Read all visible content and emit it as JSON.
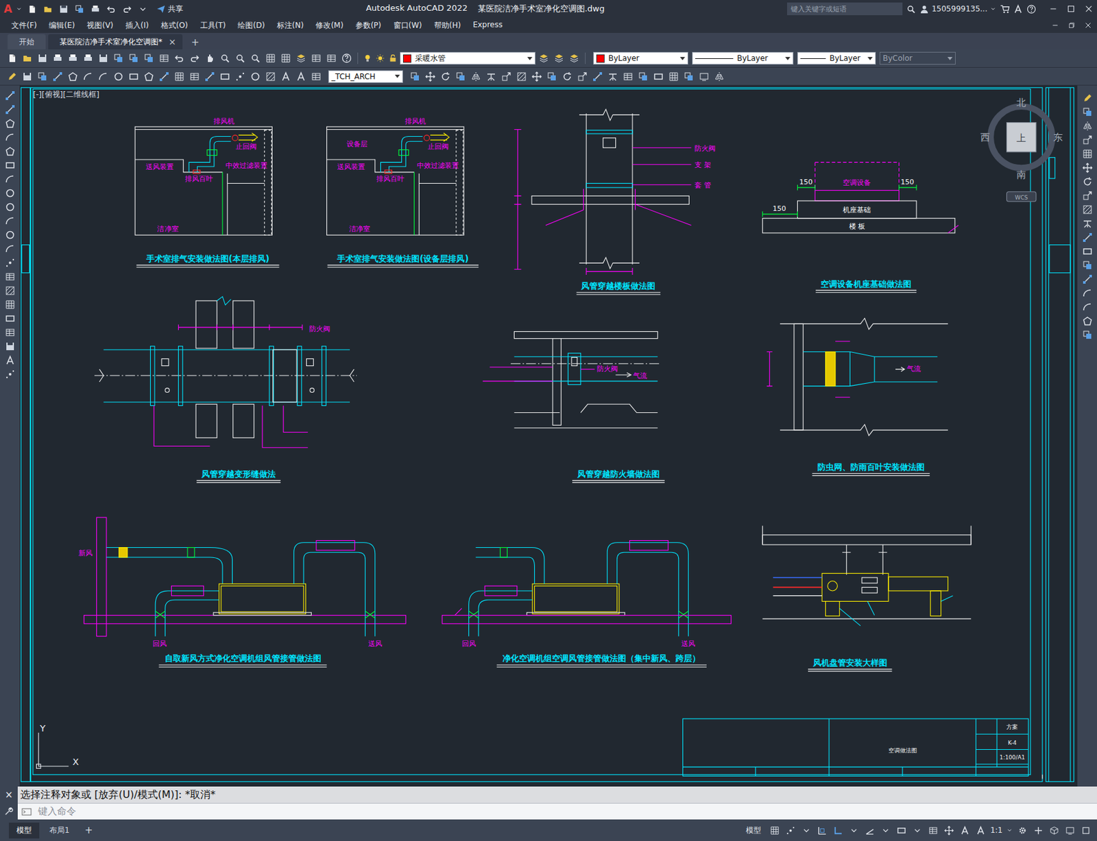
{
  "window": {
    "logo": "A",
    "app": "Autodesk AutoCAD 2022",
    "file": "某医院洁净手术室净化空调图.dwg",
    "share": "共享",
    "search_placeholder": "键入关键字或短语",
    "user": "1505999135..."
  },
  "menu": [
    "文件(F)",
    "编辑(E)",
    "视图(V)",
    "插入(I)",
    "格式(O)",
    "工具(T)",
    "绘图(D)",
    "标注(N)",
    "修改(M)",
    "参数(P)",
    "窗口(W)",
    "帮助(H)",
    "Express"
  ],
  "doc_tabs": [
    {
      "label": "开始",
      "selected": false,
      "closable": false
    },
    {
      "label": "某医院洁净手术室净化空调图*",
      "selected": true,
      "closable": true
    }
  ],
  "tab_close": "×",
  "tab_add": "+",
  "properties": {
    "layer": "采暖水管",
    "layer_color": "#ff0000",
    "color": "ByLayer",
    "color_swatch": "#ff0000",
    "linetype": "ByLayer",
    "lineweight": "ByLayer",
    "plotstyle": "ByColor",
    "plotstyle_disabled": true
  },
  "text_style": "_TCH_ARCH",
  "viewport": {
    "label": "[-][俯视][二维线框]",
    "compass": {
      "north": "北",
      "south": "南",
      "west": "西",
      "east": "东",
      "top": "上",
      "wcs": "WCS"
    },
    "ucs": {
      "x": "X",
      "y": "Y"
    }
  },
  "details": [
    {
      "title": "手术室排气安装做法图(本层排风)",
      "labels": [
        {
          "text": "排风机",
          "color": "#ff00ff"
        },
        {
          "text": "止回阀",
          "color": "#ff00ff"
        },
        {
          "text": "送风装置",
          "color": "#ff00ff"
        },
        {
          "text": "中效过滤装置",
          "color": "#ff00ff"
        },
        {
          "text": "排风百叶",
          "color": "#ff00ff"
        },
        {
          "text": "洁净室",
          "color": "#ff00ff"
        }
      ]
    },
    {
      "title": "手术室排气安装做法图(设备层排风)",
      "labels": [
        {
          "text": "排风机",
          "color": "#ff00ff"
        },
        {
          "text": "设备层",
          "color": "#ff00ff"
        },
        {
          "text": "止回阀",
          "color": "#ff00ff"
        },
        {
          "text": "送风装置",
          "color": "#ff00ff"
        },
        {
          "text": "中效过滤装置",
          "color": "#ff00ff"
        },
        {
          "text": "排风百叶",
          "color": "#ff00ff"
        },
        {
          "text": "洁净室",
          "color": "#ff00ff"
        }
      ]
    },
    {
      "title": "风管穿越楼板做法图",
      "labels": [
        {
          "text": "防火阀",
          "color": "#ff00ff"
        },
        {
          "text": "支 架",
          "color": "#ff00ff"
        },
        {
          "text": "套 管",
          "color": "#ff00ff"
        }
      ]
    },
    {
      "title": "空调设备机座基础做法图",
      "labels": [
        {
          "text": "空调设备",
          "color": "#ff00ff"
        },
        {
          "text": "150",
          "color": "#ffffff"
        },
        {
          "text": "150",
          "color": "#ffffff"
        },
        {
          "text": "150",
          "color": "#ffffff"
        },
        {
          "text": "机座基础",
          "color": "#ffffff"
        },
        {
          "text": "楼 板",
          "color": "#ffffff"
        }
      ]
    },
    {
      "title": "风管穿越变形缝做法",
      "labels": [
        {
          "text": "防火阀",
          "color": "#ff00ff"
        }
      ]
    },
    {
      "title": "风管穿越防火墙做法图",
      "labels": [
        {
          "text": "防火阀",
          "color": "#ff00ff"
        },
        {
          "text": "气流",
          "color": "#ff00ff"
        }
      ]
    },
    {
      "title": "防虫网、防雨百叶安装做法图",
      "labels": [
        {
          "text": "气流",
          "color": "#ff00ff"
        }
      ]
    },
    {
      "title": "自取新风方式净化空调机组风管接管做法图",
      "labels": [
        {
          "text": "新风",
          "color": "#ff00ff"
        },
        {
          "text": "回风",
          "color": "#ff00ff"
        },
        {
          "text": "送风",
          "color": "#ff00ff"
        }
      ]
    },
    {
      "title": "净化空调机组空调风管接管做法图（集中新风、跨层）",
      "labels": [
        {
          "text": "回风",
          "color": "#ff00ff"
        },
        {
          "text": "送风",
          "color": "#ff00ff"
        }
      ]
    },
    {
      "title": "风机盘管安装大样图",
      "labels": []
    }
  ],
  "title_block": {
    "drawing_name": "空调做法图",
    "stage": "方案",
    "number": "K-4",
    "scale": "1:100/A1"
  },
  "command": {
    "close": "×",
    "history": "选择注释对象或 [放弃(U)/模式(M)]: *取消*",
    "placeholder": "键入命令"
  },
  "status_bar": {
    "layouts": [
      {
        "label": "模型",
        "selected": true
      },
      {
        "label": "布局1",
        "selected": false
      }
    ],
    "add": "+",
    "space": "模型",
    "scale": "1:1"
  }
}
